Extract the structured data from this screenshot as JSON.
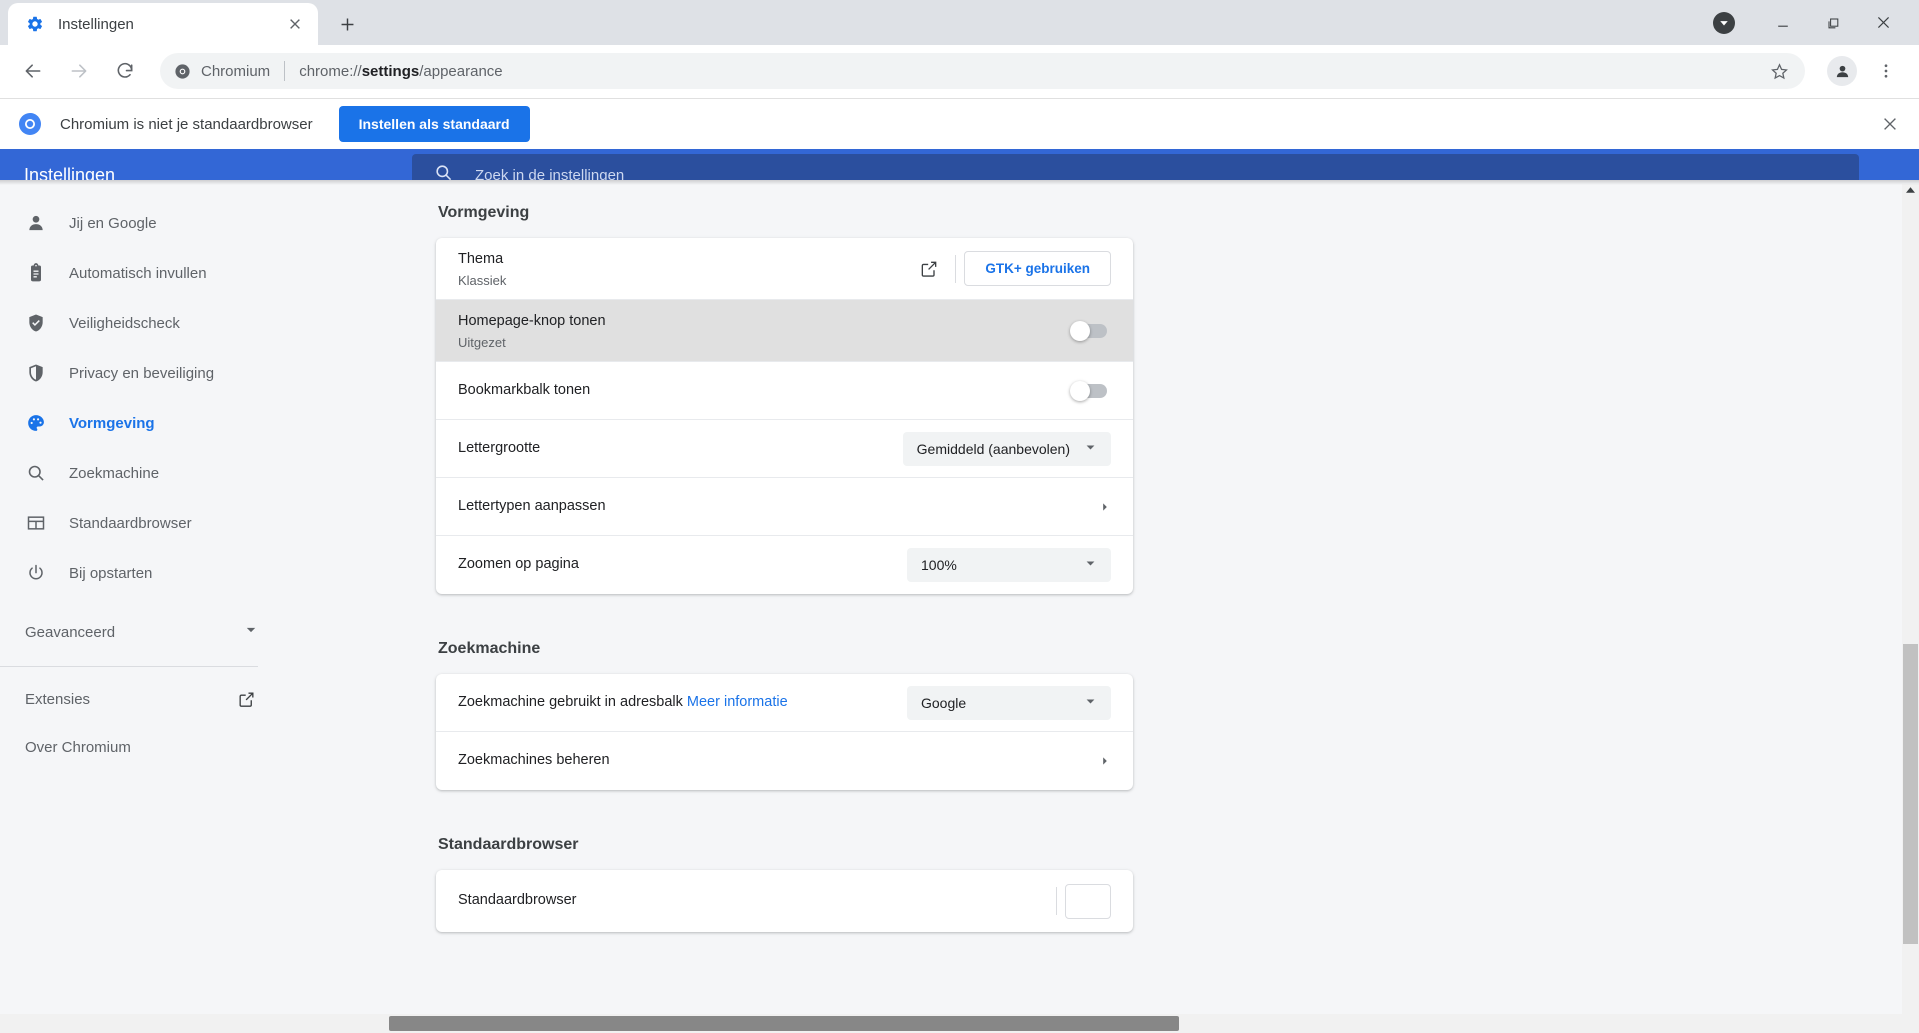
{
  "window": {
    "tab": {
      "title": "Instellingen",
      "favicon": "gear-icon",
      "close": "×"
    },
    "newtab_label": "+",
    "controls": {
      "download": "download-icon",
      "minimize": "−",
      "maximize": "□",
      "close": "×"
    }
  },
  "toolbar": {
    "back": "back-icon",
    "forward": "forward-icon",
    "reload": "reload-icon",
    "omnibox": {
      "chip_label": "Chromium",
      "chip_icon": "chromium-icon",
      "url_prefix": "chrome://",
      "url_bold": "settings",
      "url_suffix": "/appearance",
      "star_icon": "star-icon"
    },
    "profile_icon": "person-icon",
    "menu_icon": "three-dot-menu-icon"
  },
  "banner": {
    "icon": "chromium-icon",
    "message": "Chromium is niet je standaardbrowser",
    "button_label": "Instellen als standaard",
    "close_icon": "close-icon"
  },
  "settings_header": {
    "title": "Instellingen",
    "search_icon": "search-icon",
    "search_placeholder": "Zoek in de instellingen",
    "bg_color": "#3367d6",
    "search_bg_color": "#2b4f9e"
  },
  "sidebar": {
    "items": [
      {
        "label": "Jij en Google",
        "icon": "person-icon",
        "active": false
      },
      {
        "label": "Automatisch invullen",
        "icon": "clipboard-icon",
        "active": false
      },
      {
        "label": "Veiligheidscheck",
        "icon": "shield-check-icon",
        "active": false
      },
      {
        "label": "Privacy en beveiliging",
        "icon": "shield-icon",
        "active": false
      },
      {
        "label": "Vormgeving",
        "icon": "palette-icon",
        "active": true
      },
      {
        "label": "Zoekmachine",
        "icon": "search-icon",
        "active": false
      },
      {
        "label": "Standaardbrowser",
        "icon": "browser-window-icon",
        "active": false
      },
      {
        "label": "Bij opstarten",
        "icon": "power-icon",
        "active": false
      }
    ],
    "advanced": {
      "label": "Geavanceerd",
      "icon": "chevron-down-icon"
    },
    "extras": [
      {
        "label": "Extensies",
        "icon": "external-link-icon"
      },
      {
        "label": "Over Chromium",
        "icon": null
      }
    ],
    "active_color": "#1a73e8"
  },
  "main": {
    "sections": [
      {
        "title": "Vormgeving",
        "rows": [
          {
            "label": "Thema",
            "sublabel": "Klassiek",
            "control": "theme",
            "external_icon": "external-link-icon",
            "button_label": "GTK+ gebruiken",
            "highlight": false
          },
          {
            "label": "Homepage-knop tonen",
            "sublabel": "Uitgezet",
            "control": "toggle",
            "toggle_on": false,
            "highlight": true
          },
          {
            "label": "Bookmarkbalk tonen",
            "sublabel": null,
            "control": "toggle",
            "toggle_on": false,
            "highlight": false
          },
          {
            "label": "Lettergrootte",
            "sublabel": null,
            "control": "select",
            "value": "Gemiddeld (aanbevolen)",
            "highlight": false
          },
          {
            "label": "Lettertypen aanpassen",
            "sublabel": null,
            "control": "arrow",
            "highlight": false
          },
          {
            "label": "Zoomen op pagina",
            "sublabel": null,
            "control": "select",
            "value": "100%",
            "highlight": false
          }
        ]
      },
      {
        "title": "Zoekmachine",
        "rows": [
          {
            "label": "Zoekmachine gebruikt in adresbalk",
            "link_label": "Meer informatie",
            "sublabel": null,
            "control": "select",
            "value": "Google",
            "highlight": false
          },
          {
            "label": "Zoekmachines beheren",
            "sublabel": null,
            "control": "arrow",
            "highlight": false
          }
        ]
      },
      {
        "title": "Standaardbrowser",
        "rows": [
          {
            "label": "Standaardbrowser",
            "sublabel": null,
            "control": "cut",
            "highlight": false
          }
        ]
      }
    ]
  },
  "scrollbars": {
    "vertical_position": "lower-middle",
    "horizontal_position": "centered"
  }
}
